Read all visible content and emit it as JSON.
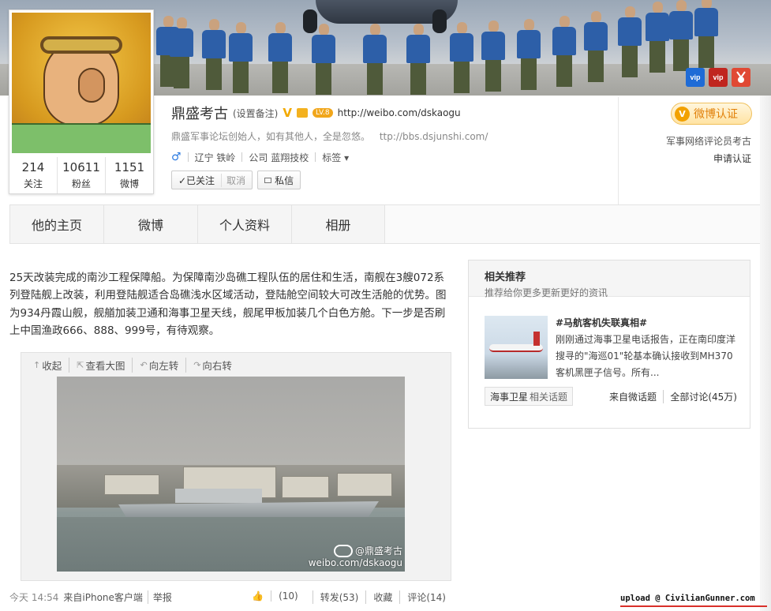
{
  "banner": {
    "badges": [
      {
        "icon": "vip3-icon",
        "label": "vip",
        "color": "#1e6bd6"
      },
      {
        "icon": "vip-red-icon",
        "label": "vip",
        "color": "#c0261f"
      },
      {
        "icon": "medal-icon",
        "label": "",
        "color": "#e04934"
      }
    ]
  },
  "profile": {
    "name": "鼎盛考古",
    "remark": "(设置备注)",
    "v_mark": "V",
    "level": "LV.8",
    "url": "http://weibo.com/dskaogu",
    "bio": "鼎盛军事论坛创始人，如有其他人，全是忽悠。",
    "bio_link": "ttp://bbs.dsjunshi.com/",
    "gender_icon": "male-icon",
    "location": "辽宁 铁岭",
    "company": "公司 蓝翔技校",
    "tags_label": "标签",
    "follow_label": "✓已关注",
    "unfollow_label": "取消",
    "message_label": "私信",
    "stats": [
      {
        "num": "214",
        "label": "关注"
      },
      {
        "num": "10611",
        "label": "粉丝"
      },
      {
        "num": "1151",
        "label": "微博"
      }
    ]
  },
  "verify": {
    "badge_letter": "V",
    "badge_text": "微博认证",
    "desc": "军事网络评论员考古",
    "apply": "申请认证",
    "accent": "#f2a100"
  },
  "tabs": [
    {
      "label": "他的主页"
    },
    {
      "label": "微博"
    },
    {
      "label": "个人资料"
    },
    {
      "label": "相册"
    }
  ],
  "post": {
    "text": "25天改装完成的南沙工程保障船。为保障南沙岛礁工程队伍的居住和生活，南舰在3艘072系列登陆舰上改装，利用登陆舰适合岛礁浅水区域活动，登陆舱空间较大可改生活舱的优势。图为934丹霞山舰，舰艏加装卫通和海事卫星天线，舰尾甲板加装几个白色方舱。下一步是否刷上中国渔政666、888、999号，有待观察。",
    "tools": [
      {
        "icon": "collapse-icon",
        "glyph": "↑",
        "label": "收起"
      },
      {
        "icon": "enlarge-icon",
        "glyph": "⇱",
        "label": "查看大图"
      },
      {
        "icon": "rotate-left-icon",
        "glyph": "↶",
        "label": "向左转"
      },
      {
        "icon": "rotate-right-icon",
        "glyph": "↷",
        "label": "向右转"
      }
    ],
    "watermark_name": "@鼎盛考古",
    "watermark_url": "weibo.com/dskaogu",
    "time": "今天 14:54",
    "source": "来自iPhone客户端",
    "report": "举报",
    "like": "(10)",
    "repost": "转发(53)",
    "favorite": "收藏",
    "comment": "评论(14)"
  },
  "sidebar": {
    "title": "相关推荐",
    "subtitle": "推荐给你更多更新更好的资讯",
    "item_title": "#马航客机失联真相#",
    "item_desc": "刚刚通过海事卫星电话报告，正在南印度洋搜寻的\"海巡01\"轮基本确认接收到MH370客机黑匣子信号。所有...",
    "topic_main": "海事卫星",
    "topic_suffix": "相关话题",
    "from": "来自微话题",
    "all": "全部讨论(45万)"
  },
  "watermark": {
    "text": "upload @ CivilianGunner.com"
  }
}
